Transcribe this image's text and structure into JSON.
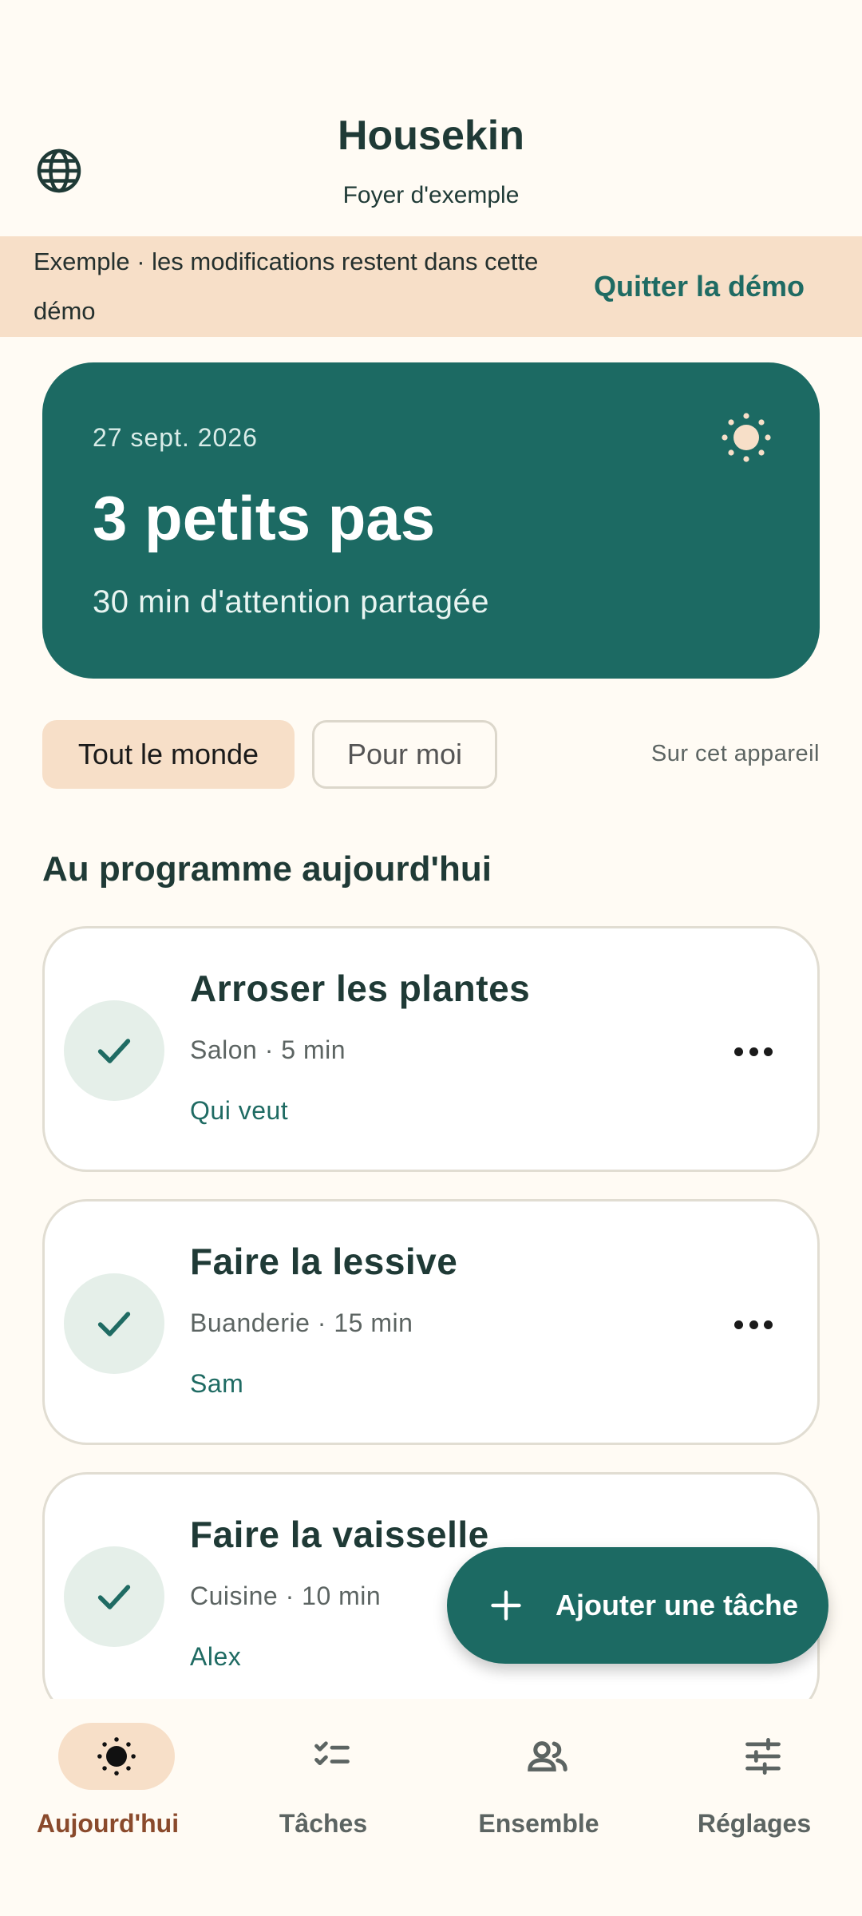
{
  "header": {
    "title": "Housekin",
    "household": "Foyer d'exemple",
    "language_icon": "globe-icon"
  },
  "banner": {
    "text": "Exemple · les modifications restent dans cette démo",
    "action": "Quitter la démo"
  },
  "hero": {
    "date": "27 sept. 2026",
    "title": "3 petits pas",
    "subtitle": "30 min d'attention partagée",
    "icon": "sun-icon"
  },
  "filters": {
    "everyone": "Tout le monde",
    "mine": "Pour moi",
    "device_note": "Sur cet appareil",
    "selected": "Tout le monde"
  },
  "section_title": "Au programme aujourd'hui",
  "tasks": [
    {
      "name": "Arroser les plantes",
      "meta": "Salon · 5 min",
      "assignee": "Qui veut"
    },
    {
      "name": "Faire la lessive",
      "meta": "Buanderie · 15 min",
      "assignee": "Sam"
    },
    {
      "name": "Faire la vaisselle",
      "meta": "Cuisine · 10 min",
      "assignee": "Alex"
    }
  ],
  "fab": {
    "label": "Ajouter une tâche"
  },
  "nav": {
    "today": "Aujourd'hui",
    "tasks": "Tâches",
    "together": "Ensemble",
    "settings": "Réglages",
    "active": "today"
  },
  "colors": {
    "primary": "#1C6A63",
    "accent_peach": "#F7DFC8",
    "background": "#FFFBF4",
    "active_nav_label": "#8A4A2C"
  }
}
